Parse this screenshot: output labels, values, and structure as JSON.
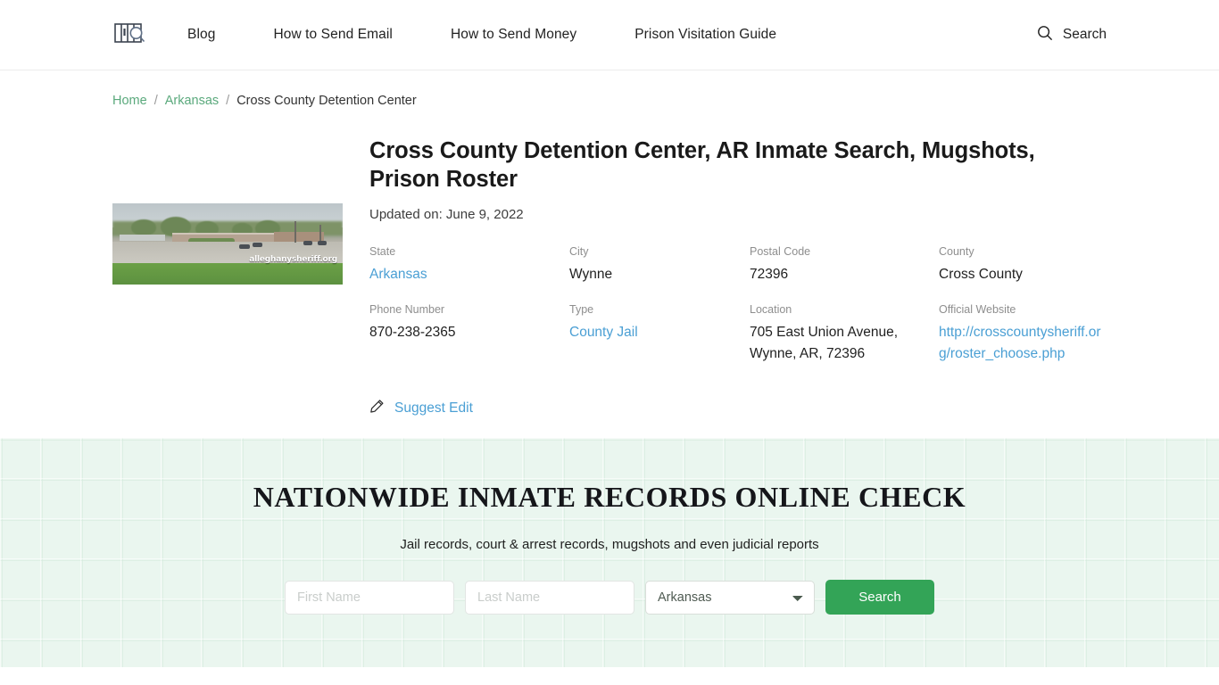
{
  "header": {
    "logo_icon": "jail-bars-magnifier-logo",
    "nav": [
      {
        "label": "Blog"
      },
      {
        "label": "How to Send Email"
      },
      {
        "label": "How to Send Money"
      },
      {
        "label": "Prison Visitation Guide"
      }
    ],
    "search": {
      "icon": "search-icon",
      "label": "Search"
    }
  },
  "breadcrumb": {
    "home": "Home",
    "state": "Arkansas",
    "current": "Cross County Detention Center",
    "separator": "/"
  },
  "facility": {
    "title": "Cross County Detention Center, AR Inmate Search, Mugshots, Prison Roster",
    "updated": "Updated on: June 9, 2022",
    "photo_watermark": "alleghanysheriff.org",
    "fields": [
      {
        "label": "State",
        "value": "Arkansas",
        "is_link": true
      },
      {
        "label": "City",
        "value": "Wynne",
        "is_link": false
      },
      {
        "label": "Postal Code",
        "value": "72396",
        "is_link": false
      },
      {
        "label": "County",
        "value": "Cross County",
        "is_link": false
      },
      {
        "label": "Phone Number",
        "value": "870-238-2365",
        "is_link": false
      },
      {
        "label": "Type",
        "value": "County Jail",
        "is_link": true
      },
      {
        "label": "Location",
        "value": "705 East Union Avenue, Wynne, AR, 72396",
        "is_link": false
      },
      {
        "label": "Official Website",
        "value": "http://crosscountysheriff.org/roster_choose.php",
        "is_link": true
      }
    ],
    "suggest_edit": {
      "icon": "pencil-icon",
      "label": "Suggest Edit"
    }
  },
  "nationwide": {
    "heading": "NATIONWIDE INMATE RECORDS ONLINE CHECK",
    "subheading": "Jail records, court & arrest records, mugshots and even judicial reports",
    "form": {
      "first_name_placeholder": "First Name",
      "first_name_value": "",
      "last_name_placeholder": "Last Name",
      "last_name_value": "",
      "state_selected": "Arkansas",
      "state_options": [
        "Arkansas"
      ],
      "search_button": "Search"
    }
  },
  "colors": {
    "accent_green": "#33a457",
    "breadcrumb_link": "#5aa97c",
    "link_blue": "#4a9fd4",
    "section_bg": "#eaf6ef"
  }
}
